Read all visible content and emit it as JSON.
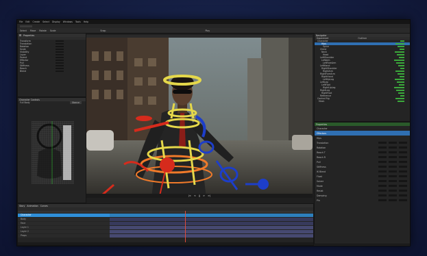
{
  "titlebar": {
    "menus": [
      "File",
      "Edit",
      "Create",
      "Select",
      "Display",
      "Windows",
      "Tools",
      "Help"
    ]
  },
  "toolbar": {
    "items": [
      "Select",
      "Move",
      "Rotate",
      "Scale",
      "Snap",
      "Play"
    ]
  },
  "left_panel": {
    "title": "Properties",
    "rows": [
      "Transform",
      "Translation",
      "Rotation",
      "Scale",
      "Visibility",
      "Layer",
      "Parent",
      "Effector",
      "Pull",
      "Stiffness",
      "Reach",
      "Blend"
    ]
  },
  "left_lower": {
    "title": "Character Controls",
    "subtitle": "Full Body",
    "button": "Stance"
  },
  "outliner": {
    "title": "Navigator",
    "tabs": [
      "Dopesheet",
      "Outliner"
    ],
    "rows": [
      "Character",
      "Hips",
      "Spine",
      "Chest",
      "Neck",
      "Head",
      "LeftShoulder",
      "LeftArm",
      "LeftForeArm",
      "LeftHand",
      "RightShoulder",
      "RightArm",
      "RightForeArm",
      "RightHand",
      "LeftUpLeg",
      "LeftLeg",
      "LeftFoot",
      "RightUpLeg",
      "RightLeg",
      "RightFoot",
      "Reference",
      "Control Rig",
      "Mesh"
    ]
  },
  "attributes": {
    "title": "Properties",
    "rows": [
      "Character",
      "Effectors",
      "Hips",
      "Translation",
      "Rotation",
      "Reach T",
      "Reach R",
      "Pull",
      "Stiffness",
      "IK Blend",
      "Float",
      "Solver",
      "Mode",
      "Resist",
      "Damping",
      "Pin"
    ]
  },
  "timeline": {
    "tabs": [
      "Story",
      "Animation",
      "Curves"
    ],
    "tracks": [
      "Character",
      "Body",
      "Face",
      "Layer 1",
      "Layer 2",
      "Props"
    ],
    "playhead_fraction": 0.38
  },
  "viewport": {
    "controls": [
      "|<",
      "<",
      "||",
      ">",
      ">|"
    ]
  },
  "colors": {
    "accent_blue": "#2f8fd8",
    "key_green": "#3ba93b",
    "effector_yellow": "#e5d84a",
    "effector_red": "#d62b1c",
    "effector_blue": "#1d3ec9",
    "effector_orange": "#f07a2a"
  }
}
